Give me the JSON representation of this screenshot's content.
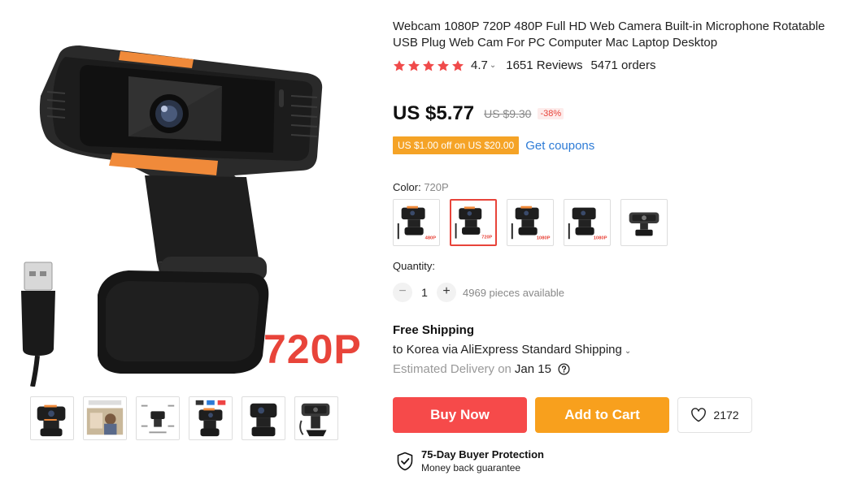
{
  "product": {
    "title": "Webcam 1080P 720P 480P Full HD Web Camera Built-in Microphone Rotatable USB Plug Web Cam For PC Computer Mac Laptop Desktop",
    "image_label": "720P",
    "rating_value": "4.7",
    "rating_chevron": "⌄",
    "reviews": "1651 Reviews",
    "orders": "5471 orders",
    "star_count": 5
  },
  "price": {
    "current": "US $5.77",
    "original": "US $9.30",
    "discount": "-38%"
  },
  "coupon": {
    "tag": "US $1.00 off on US $20.00",
    "link": "Get coupons"
  },
  "color": {
    "label": "Color:",
    "selected": "720P",
    "options": [
      "480P",
      "720P",
      "1080P",
      "1080P",
      ""
    ]
  },
  "quantity": {
    "label": "Quantity:",
    "minus": "−",
    "value": "1",
    "plus": "+",
    "available": "4969 pieces available"
  },
  "shipping": {
    "title": "Free Shipping",
    "method": "to Korea via AliExpress Standard Shipping",
    "chevron": "⌄",
    "delivery_label": "Estimated Delivery on",
    "delivery_date": "Jan 15"
  },
  "actions": {
    "buy_now": "Buy Now",
    "add_to_cart": "Add to Cart",
    "wishlist_count": "2172"
  },
  "protection": {
    "title": "75-Day Buyer Protection",
    "subtitle": "Money back guarantee"
  },
  "colors": {
    "accent_red": "#f64a4a",
    "accent_orange": "#f8a01d",
    "coupon_orange": "#f5a326",
    "link_blue": "#2d7bd6",
    "star_red": "#f04a4a"
  },
  "icons": [
    "star-icon",
    "chevron-down-icon",
    "help-icon",
    "heart-icon",
    "shield-check-icon"
  ]
}
